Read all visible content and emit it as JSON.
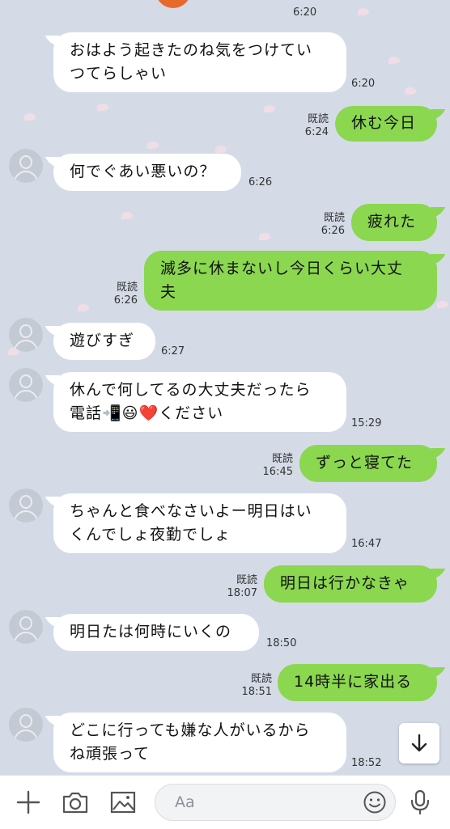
{
  "messages": [
    {
      "side": "in",
      "avatar": false,
      "lines": [
        "おはよう起きたのね気をつけてい",
        "つてらしゃい"
      ],
      "time": "6:20",
      "read": ""
    },
    {
      "side": "out",
      "lines": [
        "休む今日"
      ],
      "time": "6:24",
      "read": "既読"
    },
    {
      "side": "in",
      "avatar": true,
      "lines": [
        "何でぐあい悪いの？"
      ],
      "time": "6:26",
      "read": ""
    },
    {
      "side": "out",
      "lines": [
        "疲れた"
      ],
      "time": "6:26",
      "read": "既読"
    },
    {
      "side": "out",
      "lines": [
        "滅多に休まないし今日くらい大丈",
        "夫"
      ],
      "time": "6:26",
      "read": "既読"
    },
    {
      "side": "in",
      "avatar": true,
      "lines": [
        "遊びすぎ"
      ],
      "time": "6:27",
      "read": ""
    },
    {
      "side": "in",
      "avatar": true,
      "lines": [
        "休んで何してるの大丈夫だったら",
        "電話📲😃❤️ください"
      ],
      "time": "15:29",
      "read": ""
    },
    {
      "side": "out",
      "lines": [
        "ずっと寝てた"
      ],
      "time": "16:45",
      "read": "既読"
    },
    {
      "side": "in",
      "avatar": true,
      "lines": [
        "ちゃんと食べなさいよー明日はい",
        "くんでしょ夜勤でしょ"
      ],
      "time": "16:47",
      "read": ""
    },
    {
      "side": "out",
      "lines": [
        "明日は行かなきゃ"
      ],
      "time": "18:07",
      "read": "既読"
    },
    {
      "side": "in",
      "avatar": true,
      "lines": [
        "明日たは何時にいくの"
      ],
      "time": "18:50",
      "read": ""
    },
    {
      "side": "out",
      "lines": [
        "14時半に家出る"
      ],
      "time": "18:51",
      "read": "既読"
    },
    {
      "side": "in",
      "avatar": true,
      "lines": [
        "どこに行っても嫌な人がいるから",
        "ね頑張って"
      ],
      "time": "18:52",
      "read": ""
    }
  ],
  "prev_time": "6:20",
  "input": {
    "placeholder": "Aa"
  },
  "icons": {
    "add": "plus-icon",
    "camera": "camera-icon",
    "image": "image-icon",
    "emoji": "emoji-icon",
    "mic": "microphone-icon",
    "scroll": "arrow-down-icon"
  },
  "colors": {
    "background": "#d4dbe7",
    "outgoing": "#8bd750",
    "incoming": "#ffffff"
  }
}
